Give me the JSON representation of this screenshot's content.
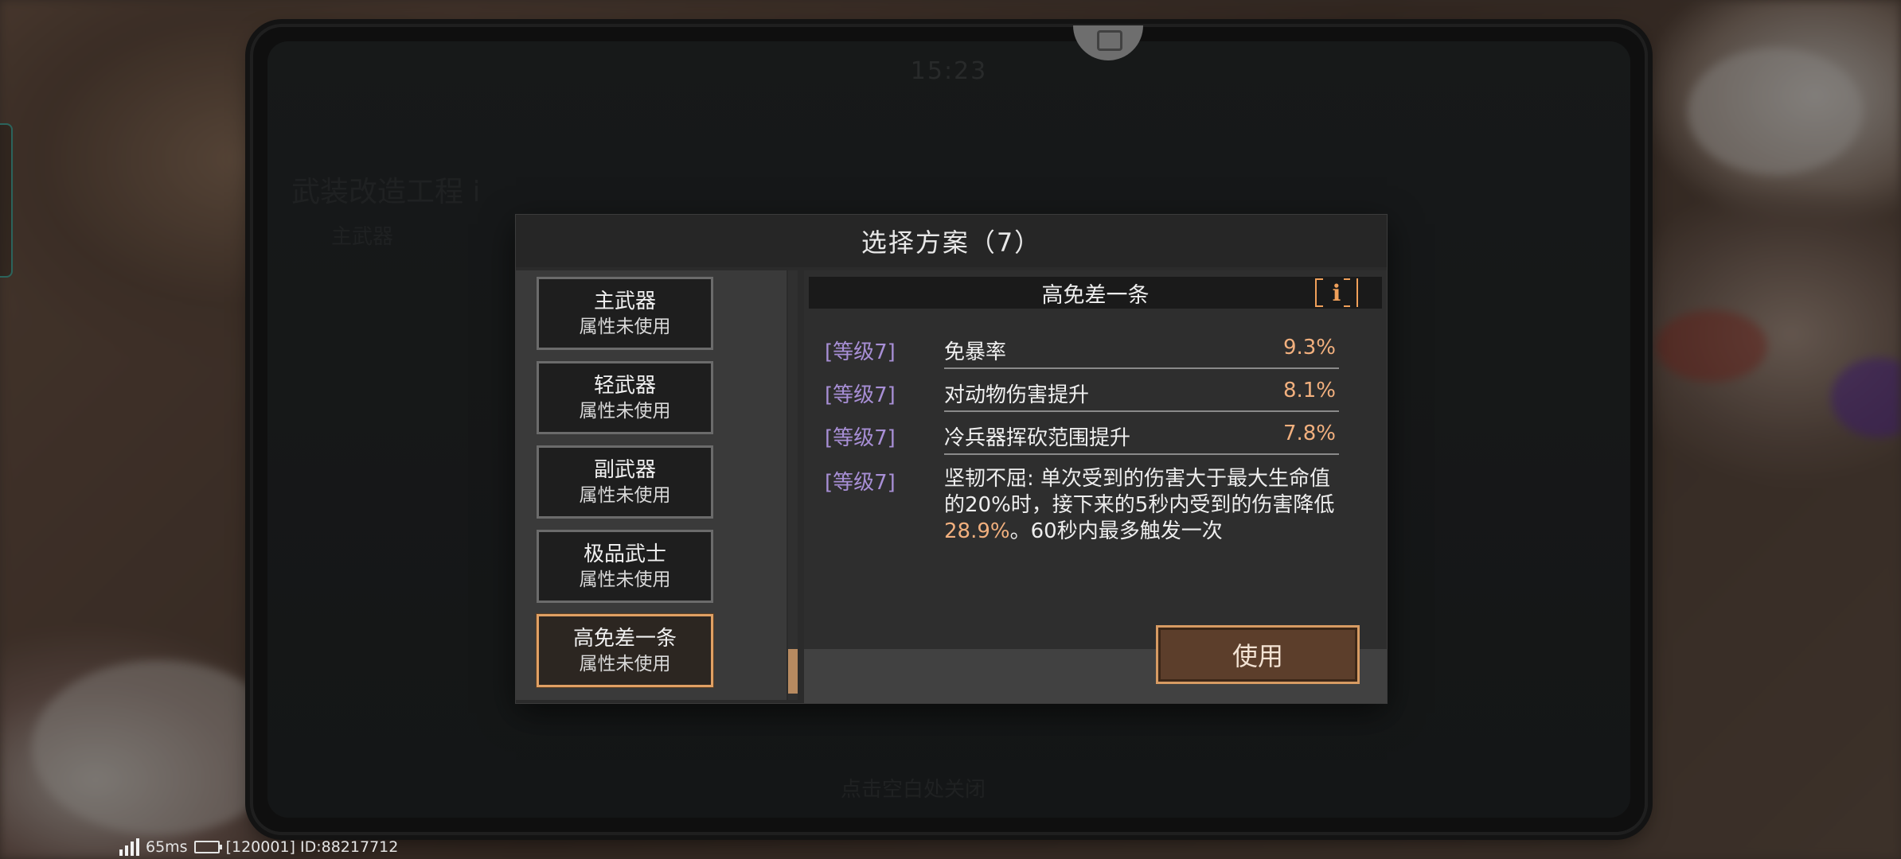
{
  "tablet": {
    "time": "15:23",
    "ghost_texts": [
      "武装改造工程 i",
      "主武器",
      "点击空白处关闭"
    ]
  },
  "dialog": {
    "title": "选择方案（7）",
    "plans": [
      {
        "name": "主武器",
        "status": "属性未使用",
        "selected": false
      },
      {
        "name": "轻武器",
        "status": "属性未使用",
        "selected": false
      },
      {
        "name": "副武器",
        "status": "属性未使用",
        "selected": false
      },
      {
        "name": "极品武士",
        "status": "属性未使用",
        "selected": false
      },
      {
        "name": "高免差一条",
        "status": "属性未使用",
        "selected": true
      }
    ],
    "detail": {
      "title": "高免差一条",
      "info_icon": "info-icon",
      "attributes": [
        {
          "level": "[等级7]",
          "name": "免暴率",
          "value": "9.3%"
        },
        {
          "level": "[等级7]",
          "name": "对动物伤害提升",
          "value": "8.1%"
        },
        {
          "level": "[等级7]",
          "name": "冷兵器挥砍范围提升",
          "value": "7.8%"
        }
      ],
      "special": {
        "level": "[等级7]",
        "desc_before": "坚韧不屈: 单次受到的伤害大于最大生命值的20%时，接下来的5秒内受到的伤害降低",
        "desc_highlight": "28.9%",
        "desc_after": "。60秒内最多触发一次"
      }
    },
    "use_button": "使用"
  },
  "status_bar": {
    "ping": "65ms",
    "server_id": "[120001] ID:88217712"
  },
  "colors": {
    "accent": "#e0a064",
    "level": "#a88fd6",
    "value": "#f2b07e"
  }
}
